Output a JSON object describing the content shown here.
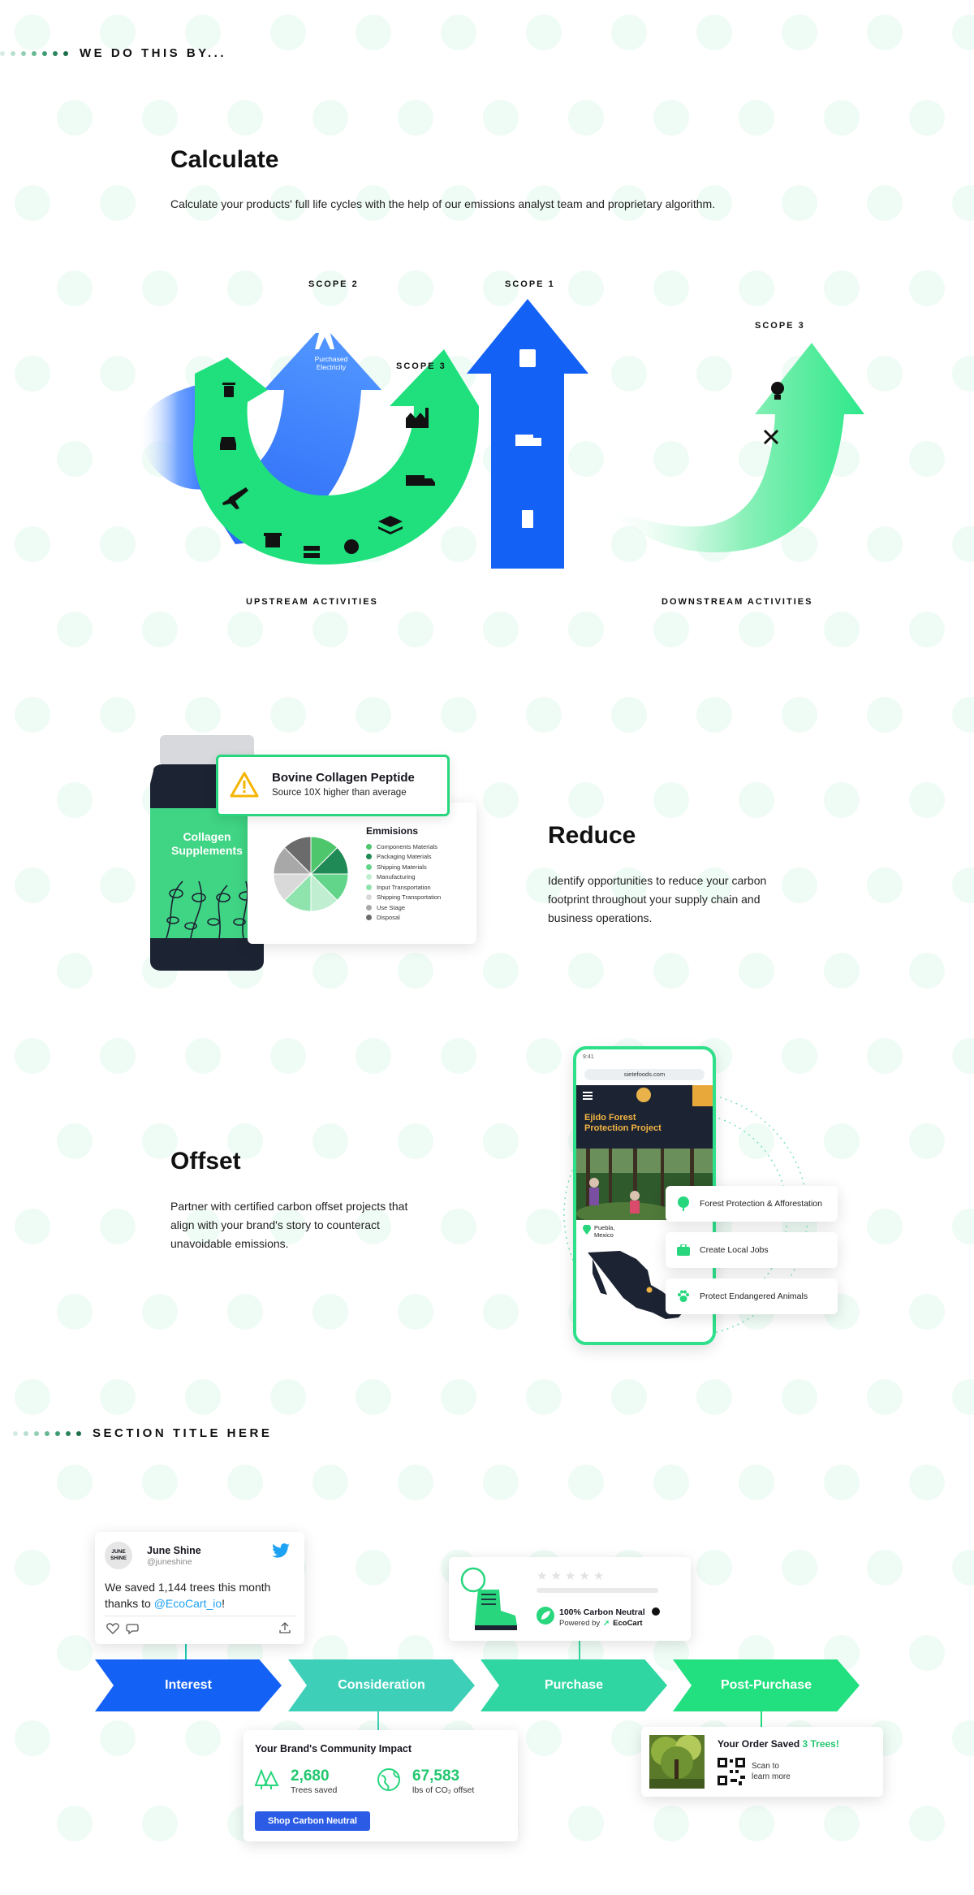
{
  "section1": {
    "eyebrow": "WE DO THIS BY..."
  },
  "calculate": {
    "title": "Calculate",
    "description": "Calculate your products' full life cycles with the help of our emissions analyst team and proprietary algorithm.",
    "scope2_label": "SCOPE 2",
    "scope1_label": "SCOPE 1",
    "scope3_upstream_label": "SCOPE 3",
    "scope3_downstream_label": "SCOPE 3",
    "purchased_electricity_line1": "Purchased",
    "purchased_electricity_line2": "Electricity",
    "upstream_caption": "UPSTREAM ACTIVITIES",
    "downstream_caption": "DOWNSTREAM ACTIVITIES"
  },
  "reduce": {
    "title": "Reduce",
    "description_line1": "Identify opportunities to reduce your carbon",
    "description_line2": "footprint throughout your supply chain and",
    "description_line3": "business operations.",
    "bottle_label_line1": "Collagen",
    "bottle_label_line2": "Supplements",
    "alert_title": "Bovine Collagen Peptide",
    "alert_subtitle": "Source 10X higher than average",
    "emissions_title": "Emmisions",
    "legend": [
      {
        "label": "Components Materials",
        "color": "#4ec66c"
      },
      {
        "label": "Packaging Materials",
        "color": "#1f8a55"
      },
      {
        "label": "Shipping Materials",
        "color": "#62d58a"
      },
      {
        "label": "Manufacturing",
        "color": "#bfeed0"
      },
      {
        "label": "Input Transportation",
        "color": "#8fe3ad"
      },
      {
        "label": "Shipping Transportation",
        "color": "#d9d9d9"
      },
      {
        "label": "Use Stage",
        "color": "#a8a8a8"
      },
      {
        "label": "Disposal",
        "color": "#6b6b6b"
      }
    ]
  },
  "offset": {
    "title": "Offset",
    "description_line1": "Partner with certified carbon offset projects that",
    "description_line2": "align with your brand's story to counteract",
    "description_line3": "unavoidable emissions.",
    "phone_time": "9:41",
    "phone_url": "sietefoods.com",
    "project_title_line1": "Ejido Forest",
    "project_title_line2": "Protection Project",
    "location_line1": "Puebla,",
    "location_line2": "Mexico",
    "benefits": [
      "Forest Protection & Afforestation",
      "Create Local Jobs",
      "Protect Endangered Animals"
    ]
  },
  "section2": {
    "eyebrow": "SECTION TITLE HERE"
  },
  "journey": {
    "stages": [
      "Interest",
      "Consideration",
      "Purchase",
      "Post-Purchase"
    ],
    "tweet": {
      "avatar_line1": "JUNE",
      "avatar_line2": "SHINE",
      "name": "June Shine",
      "handle": "@juneshine",
      "text_line1": "We saved 1,144 trees this month",
      "text_prefix": "thanks to ",
      "mention": "@EcoCart_io",
      "text_suffix": "!"
    },
    "product": {
      "carbon_neutral": "100% Carbon Neutral",
      "powered_by": "Powered by",
      "brand": "EcoCart"
    },
    "impact": {
      "title": "Your Brand's Community Impact",
      "trees_value": "2,680",
      "trees_label": "Trees saved",
      "co2_value": "67,583",
      "co2_label": "lbs of CO₂ offset",
      "button": "Shop Carbon Neutral"
    },
    "order": {
      "title_prefix": "Your Order Saved ",
      "title_highlight": "3 Trees!",
      "scan_line1": "Scan to",
      "scan_line2": "learn more"
    }
  },
  "colors": {
    "green": "#1fe07d",
    "blue": "#1461f5",
    "teal": "#3ecfb8",
    "dark_navy": "#1c2433"
  }
}
